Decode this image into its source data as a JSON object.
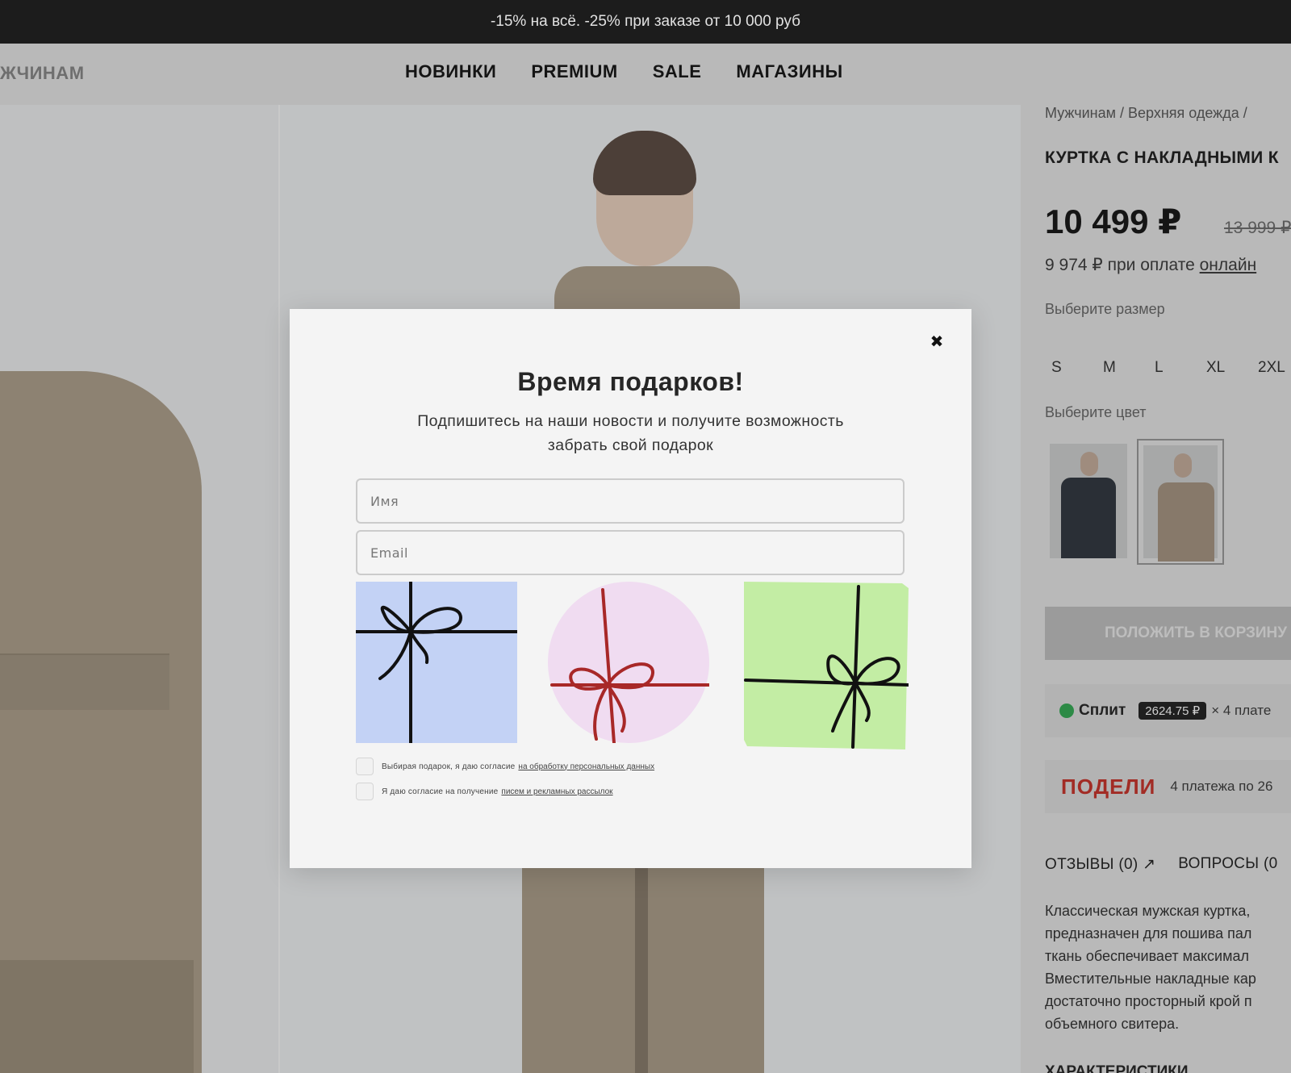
{
  "promo": {
    "text": "-15% на всё. -25% при заказе от 10 000 руб"
  },
  "nav": {
    "left_label": "ЖЧИНАМ",
    "links": [
      "НОВИНКИ",
      "PREMIUM",
      "SALE",
      "МАГАЗИНЫ"
    ]
  },
  "product": {
    "breadcrumb": "Мужчинам / Верхняя одежда /",
    "title": "КУРТКА С НАКЛАДНЫМИ К",
    "price": "10 499 ₽",
    "old_price": "13 999 ₽",
    "online_price": "9 974 ₽ при оплате",
    "online_link": "онлайн",
    "size_label": "Выберите размер",
    "sizes": [
      "S",
      "M",
      "L",
      "XL",
      "2XL"
    ],
    "color_label": "Выберите цвет",
    "colors": [
      "dark-navy",
      "beige"
    ],
    "cart_button": "ПОЛОЖИТЬ В КОРЗИНУ",
    "split": {
      "name": "Сплит",
      "amount": "2624.75 ₽",
      "tail": "× 4 плате"
    },
    "podeli": {
      "logo": "ПОДЕЛИ",
      "text": "4 платежа по 26"
    },
    "tabs": [
      "ОТЗЫВЫ (0) ↗",
      "ВОПРОСЫ (0"
    ],
    "description": [
      "Классическая мужская куртка,",
      "предназначен для пошива пал",
      "ткань обеспечивает максимал",
      "Вместительные накладные кар",
      "достаточно просторный крой п",
      "объемного свитера."
    ],
    "chars_heading": "ХАРАКТЕРИСТИКИ"
  },
  "modal": {
    "close": "✖",
    "title": "Время подарков!",
    "subtitle_line1": "Подпишитесь на наши новости и получите возможность",
    "subtitle_line2": "забрать свой подарок",
    "name_placeholder": "Имя",
    "email_placeholder": "Email",
    "gifts": [
      {
        "shape": "square",
        "fill": "#c3d2f5",
        "ribbon": "#111111"
      },
      {
        "shape": "circle",
        "fill": "#f0dcf1",
        "ribbon": "#a82828"
      },
      {
        "shape": "square",
        "fill": "#c3eda4",
        "ribbon": "#111111"
      }
    ],
    "consent_1": {
      "text": "Выбирая подарок, я даю согласие",
      "link": "на обработку персональных данных"
    },
    "consent_2": {
      "text": "Я даю согласие на получение",
      "link": "писем и рекламных рассылок"
    }
  },
  "colors": {
    "promo_bar": "#1c1c1c",
    "overlay_bg": "#bdbdbd",
    "modal_bg": "#f4f4f4",
    "podeli_red": "#a22c25",
    "split_green": "#2d8a46"
  }
}
